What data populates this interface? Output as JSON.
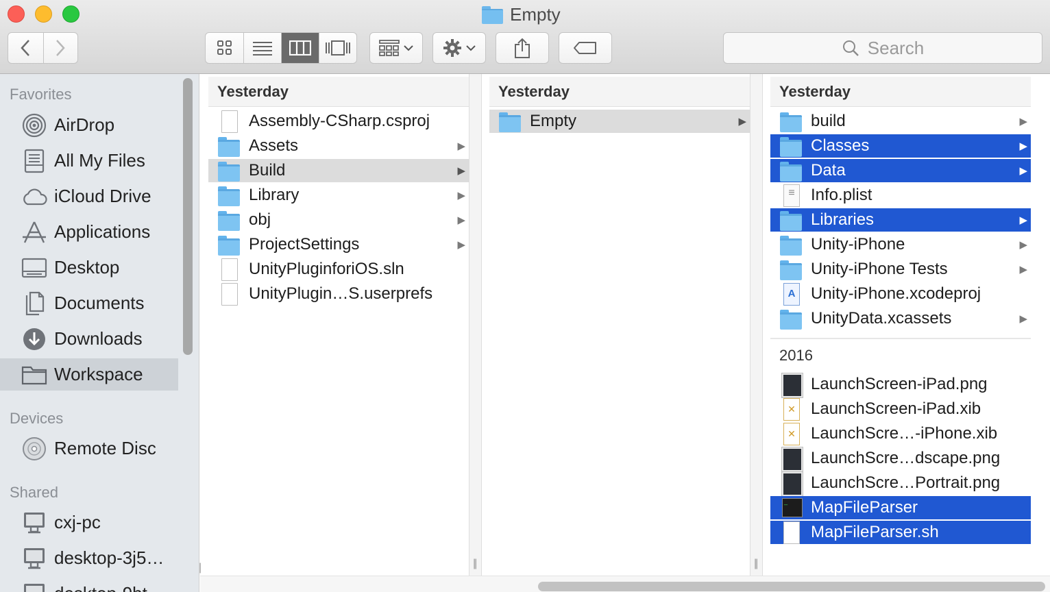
{
  "window": {
    "title": "Empty"
  },
  "toolbar": {
    "back_icon": "chevron-left-icon",
    "forward_icon": "chevron-right-icon",
    "view_icons": [
      "icon-view-icon",
      "list-view-icon",
      "column-view-icon",
      "cover-flow-icon"
    ],
    "active_view": "column",
    "search_placeholder": "Search"
  },
  "sidebar": {
    "favorites_label": "Favorites",
    "favorites": [
      {
        "label": "AirDrop",
        "icon": "airdrop-icon"
      },
      {
        "label": "All My Files",
        "icon": "all-files-icon"
      },
      {
        "label": "iCloud Drive",
        "icon": "cloud-icon"
      },
      {
        "label": "Applications",
        "icon": "applications-icon"
      },
      {
        "label": "Desktop",
        "icon": "desktop-icon"
      },
      {
        "label": "Documents",
        "icon": "documents-icon"
      },
      {
        "label": "Downloads",
        "icon": "downloads-icon"
      },
      {
        "label": "Workspace",
        "icon": "folder-icon",
        "selected": true
      }
    ],
    "devices_label": "Devices",
    "devices": [
      {
        "label": "Remote Disc",
        "icon": "disc-icon"
      }
    ],
    "shared_label": "Shared",
    "shared": [
      {
        "label": "cxj-pc",
        "icon": "computer-icon"
      },
      {
        "label": "desktop-3j5…",
        "icon": "computer-icon"
      },
      {
        "label": "desktop-9bt…",
        "icon": "computer-icon"
      }
    ]
  },
  "columns": [
    {
      "header": "Yesterday",
      "items": [
        {
          "name": "Assembly-CSharp.csproj",
          "kind": "doc"
        },
        {
          "name": "Assets",
          "kind": "folder",
          "arrow": true
        },
        {
          "name": "Build",
          "kind": "folder",
          "arrow": true,
          "state": "grey"
        },
        {
          "name": "Library",
          "kind": "folder",
          "arrow": true
        },
        {
          "name": "obj",
          "kind": "folder",
          "arrow": true
        },
        {
          "name": "ProjectSettings",
          "kind": "folder",
          "arrow": true
        },
        {
          "name": "UnityPluginforiOS.sln",
          "kind": "doc"
        },
        {
          "name": "UnityPlugin…S.userprefs",
          "kind": "doc"
        }
      ]
    },
    {
      "header": "Yesterday",
      "items": [
        {
          "name": "Empty",
          "kind": "folder",
          "arrow": true,
          "state": "grey"
        }
      ]
    },
    {
      "header": "Yesterday",
      "items": [
        {
          "name": "build",
          "kind": "folder",
          "arrow": true
        },
        {
          "name": "Classes",
          "kind": "folder",
          "arrow": true,
          "state": "blue"
        },
        {
          "name": "Data",
          "kind": "folder",
          "arrow": true,
          "state": "blue"
        },
        {
          "name": "Info.plist",
          "kind": "plist"
        },
        {
          "name": "Libraries",
          "kind": "folder",
          "arrow": true,
          "state": "blue"
        },
        {
          "name": "Unity-iPhone",
          "kind": "folder",
          "arrow": true
        },
        {
          "name": "Unity-iPhone Tests",
          "kind": "folder",
          "arrow": true
        },
        {
          "name": "Unity-iPhone.xcodeproj",
          "kind": "xcode"
        },
        {
          "name": "UnityData.xcassets",
          "kind": "folder",
          "arrow": true
        }
      ],
      "group2_header": "2016",
      "items2": [
        {
          "name": "LaunchScreen-iPad.png",
          "kind": "png"
        },
        {
          "name": "LaunchScreen-iPad.xib",
          "kind": "xib"
        },
        {
          "name": "LaunchScre…-iPhone.xib",
          "kind": "xib"
        },
        {
          "name": "LaunchScre…dscape.png",
          "kind": "png"
        },
        {
          "name": "LaunchScre…Portrait.png",
          "kind": "png"
        },
        {
          "name": "MapFileParser",
          "kind": "exec",
          "state": "blue"
        },
        {
          "name": "MapFileParser.sh",
          "kind": "sh",
          "state": "blue"
        }
      ]
    }
  ]
}
